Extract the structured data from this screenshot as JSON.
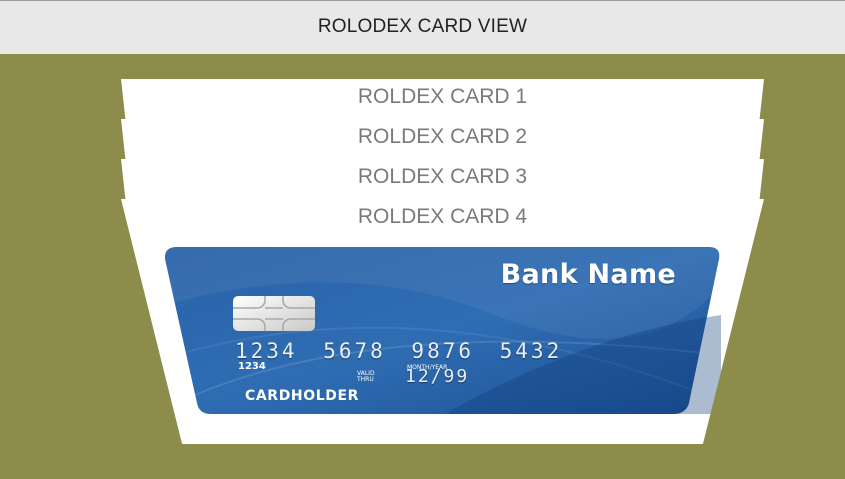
{
  "header": {
    "title": "ROLODEX CARD VIEW"
  },
  "cards": [
    {
      "label": "ROLDEX CARD 1"
    },
    {
      "label": "ROLDEX CARD 2"
    },
    {
      "label": "ROLDEX CARD 3"
    },
    {
      "label": "ROLDEX CARD 4"
    }
  ],
  "credit_card": {
    "bank_name": "Bank Name",
    "number": "1234 5678 9876 5432",
    "number_small": "1234",
    "valid_thru": "VALID THRU",
    "month_year_label": "MONTH/YEAR",
    "expiry": "12/99",
    "cardholder": "CARDHOLDER"
  },
  "colors": {
    "background": "#8e8c4a",
    "header_bg": "#e8e8e8",
    "card_blue": "#1e5aa0"
  }
}
